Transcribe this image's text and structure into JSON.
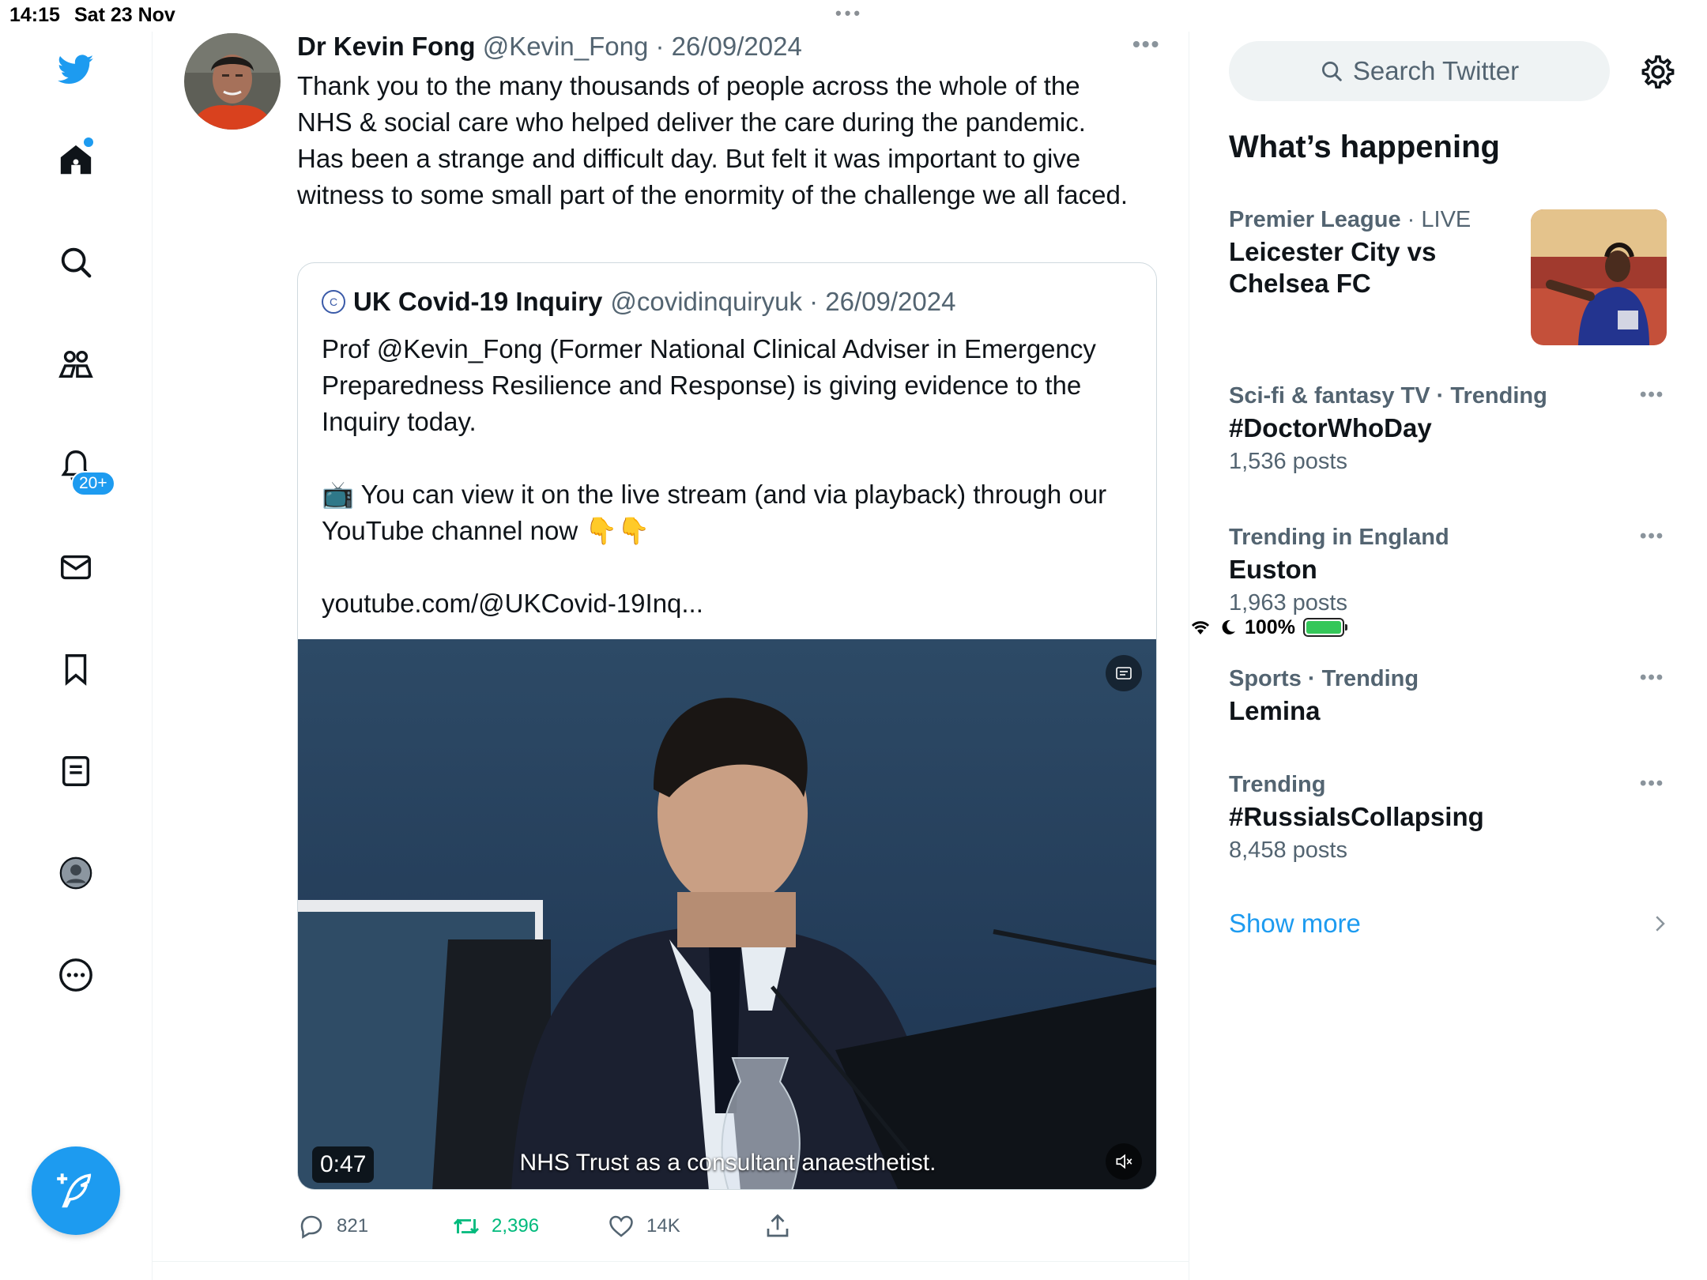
{
  "status_bar": {
    "time": "14:15",
    "date": "Sat 23 Nov",
    "battery": "100%"
  },
  "nav": {
    "notifications_badge": "20+",
    "icons": [
      "twitter-logo-icon",
      "home-icon",
      "search-icon",
      "communities-icon",
      "notifications-icon",
      "messages-icon",
      "bookmarks-icon",
      "lists-icon",
      "profile-icon",
      "more-icon"
    ]
  },
  "tweet": {
    "author_name": "Dr Kevin Fong",
    "author_meta": "@Kevin_Fong · 26/09/2024",
    "text": "Thank you to the many thousands of people across the whole of the NHS & social care who helped deliver the care during the pandemic. Has been a strange and difficult day. But felt it was important to give witness to some small part of the enormity of the challenge we all faced.",
    "quote": {
      "author_name": "UK Covid-19 Inquiry",
      "author_meta": "@covidinquiryuk · 26/09/2024",
      "text": "Prof @Kevin_Fong (Former National Clinical Adviser in Emergency Preparedness Resilience and Response) is giving evidence to the Inquiry today.\n\n📺 You can view it on the live stream (and via playback) through our YouTube channel now 👇👇\n\nyoutube.com/@UKCovid-19Inq...",
      "video": {
        "duration": "0:47",
        "caption": "NHS Trust as a consultant anaesthetist."
      }
    },
    "actions": {
      "replies": "821",
      "retweets": "2,396",
      "likes": "14K"
    }
  },
  "sidebar": {
    "search_placeholder": "Search Twitter",
    "section_title": "What’s happening",
    "featured": {
      "context": "Premier League",
      "context_suffix": " · LIVE",
      "title": "Leicester City vs Chelsea FC"
    },
    "trends": [
      {
        "context": "Sci-fi & fantasy TV · Trending",
        "title": "#DoctorWhoDay",
        "count": "1,536 posts"
      },
      {
        "context": "Trending in England",
        "title": "Euston",
        "count": "1,963 posts"
      },
      {
        "context": "Sports · Trending",
        "title": "Lemina",
        "count": ""
      },
      {
        "context": "Trending",
        "title": "#RussiaIsCollapsing",
        "count": "8,458 posts"
      }
    ],
    "show_more": "Show more"
  },
  "colors": {
    "accent": "#1d9bf0",
    "retweet_green": "#00ba7c",
    "secondary_text": "#536471"
  }
}
